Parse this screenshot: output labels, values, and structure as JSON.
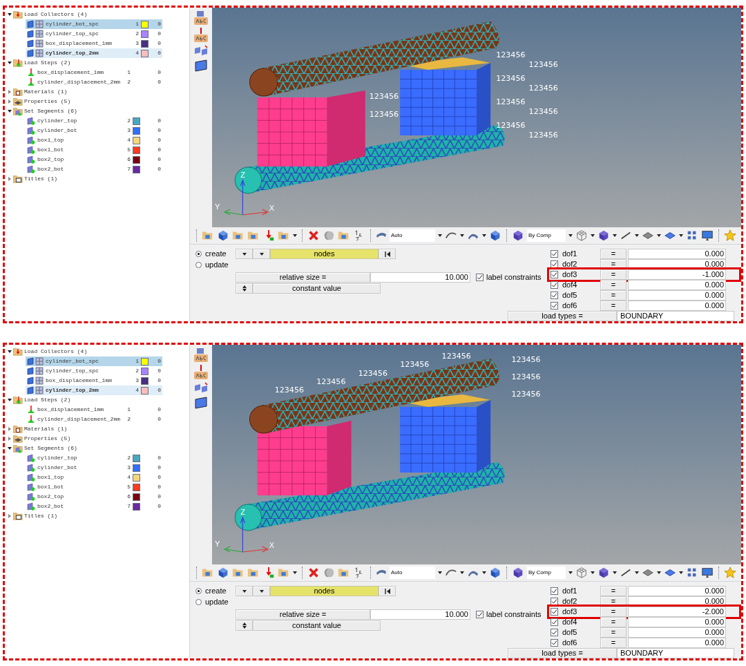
{
  "panels": [
    {
      "tree": [
        {
          "kind": "collectors",
          "label": "Load Collectors (4)",
          "expanded": true,
          "children": [
            {
              "label": "cylinder_bot_spc",
              "id": "1",
              "color": "#ffff00",
              "count": "0",
              "selected": true,
              "current": false
            },
            {
              "label": "cylinder_top_spc",
              "id": "2",
              "color": "#a982ff",
              "count": "0",
              "selected": false,
              "current": false
            },
            {
              "label": "box_displacement_1mm",
              "id": "3",
              "color": "#4a2f7f",
              "count": "0",
              "selected": false,
              "current": false
            },
            {
              "label": "cylinder_top_2mm",
              "id": "4",
              "color": "#ffbcbc",
              "count": "0",
              "selected": false,
              "current": true
            }
          ]
        },
        {
          "kind": "steps",
          "label": "Load Steps (2)",
          "expanded": true,
          "children": [
            {
              "label": "box_displacement_1mm",
              "id": "1",
              "count": "0",
              "selected": false,
              "current": false
            },
            {
              "label": "cylinder_displacement_2mm",
              "id": "2",
              "count": "0",
              "selected": false,
              "current": false
            }
          ]
        },
        {
          "kind": "materials",
          "label": "Materials (1)",
          "expanded": false
        },
        {
          "kind": "properties",
          "label": "Properties (5)",
          "expanded": false
        },
        {
          "kind": "segments",
          "label": "Set Segments (6)",
          "expanded": true,
          "children": [
            {
              "label": "cylinder_top",
              "id": "2",
              "color": "#48a8c0",
              "count": "0",
              "selected": false,
              "current": false
            },
            {
              "label": "cylinder_bot",
              "id": "3",
              "color": "#3070ff",
              "count": "0",
              "selected": false,
              "current": false
            },
            {
              "label": "box1_top",
              "id": "4",
              "color": "#f5d67a",
              "count": "0",
              "selected": false,
              "current": false
            },
            {
              "label": "box1_bot",
              "id": "5",
              "color": "#ff3a1e",
              "count": "0",
              "selected": false,
              "current": false
            },
            {
              "label": "box2_top",
              "id": "6",
              "color": "#7a0010",
              "count": "0",
              "selected": false,
              "current": false
            },
            {
              "label": "box2_bot",
              "id": "7",
              "color": "#6a2aa0",
              "count": "0",
              "selected": false,
              "current": false
            }
          ]
        },
        {
          "kind": "titles",
          "label": "Titles (1)",
          "expanded": false
        }
      ],
      "viewport": {
        "axes": [
          "Z",
          "Y",
          "X"
        ],
        "constraint_labels": [
          "123456",
          "123456",
          "123456",
          "123456",
          "123456",
          "123456",
          "123456",
          "123456",
          "123456",
          "123456"
        ]
      },
      "toolbar": {
        "mesh_mode": "Auto",
        "color_mode": "By Comp"
      },
      "form": {
        "modes": [
          {
            "label": "create",
            "selected": true
          },
          {
            "label": "update",
            "selected": false
          }
        ],
        "entity": "nodes",
        "size_label": "relative size =",
        "size_value": "10.000",
        "label_constraints": {
          "label": "label constraints",
          "checked": true
        },
        "value_mode": "constant value",
        "dofs": [
          {
            "label": "dof1",
            "checked": true,
            "operator": "=",
            "value": "0.000",
            "highlighted": false
          },
          {
            "label": "dof2",
            "checked": true,
            "operator": "=",
            "value": "0.000",
            "highlighted": false
          },
          {
            "label": "dof3",
            "checked": true,
            "operator": "=",
            "value": "-1.000",
            "highlighted": true
          },
          {
            "label": "dof4",
            "checked": true,
            "operator": "=",
            "value": "0.000",
            "highlighted": false
          },
          {
            "label": "dof5",
            "checked": true,
            "operator": "=",
            "value": "0.000",
            "highlighted": false
          },
          {
            "label": "dof6",
            "checked": true,
            "operator": "=",
            "value": "0.000",
            "highlighted": false
          }
        ],
        "load_types_label": "load types =",
        "load_types_value": "BOUNDARY"
      }
    },
    {
      "tree": [
        {
          "kind": "collectors",
          "label": "Load Collectors (4)",
          "expanded": true,
          "children": [
            {
              "label": "cylinder_bot_spc",
              "id": "1",
              "color": "#ffff00",
              "count": "0",
              "selected": true,
              "current": false
            },
            {
              "label": "cylinder_top_spc",
              "id": "2",
              "color": "#a982ff",
              "count": "0",
              "selected": false,
              "current": false
            },
            {
              "label": "box_displacement_1mm",
              "id": "3",
              "color": "#4a2f7f",
              "count": "0",
              "selected": false,
              "current": false
            },
            {
              "label": "cylinder_top_2mm",
              "id": "4",
              "color": "#ffbcbc",
              "count": "0",
              "selected": false,
              "current": true
            }
          ]
        },
        {
          "kind": "steps",
          "label": "Load Steps (2)",
          "expanded": true,
          "children": [
            {
              "label": "box_displacement_1mm",
              "id": "1",
              "count": "0",
              "selected": false,
              "current": false
            },
            {
              "label": "cylinder_displacement_2mm",
              "id": "2",
              "count": "0",
              "selected": false,
              "current": false
            }
          ]
        },
        {
          "kind": "materials",
          "label": "Materials (1)",
          "expanded": false
        },
        {
          "kind": "properties",
          "label": "Properties (5)",
          "expanded": false
        },
        {
          "kind": "segments",
          "label": "Set Segments (6)",
          "expanded": true,
          "children": [
            {
              "label": "cylinder_top",
              "id": "2",
              "color": "#48a8c0",
              "count": "0",
              "selected": false,
              "current": false
            },
            {
              "label": "cylinder_bot",
              "id": "3",
              "color": "#3070ff",
              "count": "0",
              "selected": false,
              "current": false
            },
            {
              "label": "box1_top",
              "id": "4",
              "color": "#f5d67a",
              "count": "0",
              "selected": false,
              "current": false
            },
            {
              "label": "box1_bot",
              "id": "5",
              "color": "#ff3a1e",
              "count": "0",
              "selected": false,
              "current": false
            },
            {
              "label": "box2_top",
              "id": "6",
              "color": "#7a0010",
              "count": "0",
              "selected": false,
              "current": false
            },
            {
              "label": "box2_bot",
              "id": "7",
              "color": "#6a2aa0",
              "count": "0",
              "selected": false,
              "current": false
            }
          ]
        },
        {
          "kind": "titles",
          "label": "Titles (1)",
          "expanded": false
        }
      ],
      "viewport": {
        "axes": [
          "Z",
          "Y",
          "X"
        ],
        "constraint_labels": [
          "123456",
          "123456",
          "123456",
          "123456",
          "123456",
          "123456",
          "123456",
          "123456"
        ]
      },
      "toolbar": {
        "mesh_mode": "Auto",
        "color_mode": "By Comp"
      },
      "form": {
        "modes": [
          {
            "label": "create",
            "selected": true
          },
          {
            "label": "update",
            "selected": false
          }
        ],
        "entity": "nodes",
        "size_label": "relative size =",
        "size_value": "10.000",
        "label_constraints": {
          "label": "label constraints",
          "checked": true
        },
        "value_mode": "constant value",
        "dofs": [
          {
            "label": "dof1",
            "checked": true,
            "operator": "=",
            "value": "0.000",
            "highlighted": false
          },
          {
            "label": "dof2",
            "checked": true,
            "operator": "=",
            "value": "0.000",
            "highlighted": false
          },
          {
            "label": "dof3",
            "checked": true,
            "operator": "=",
            "value": "-2.000",
            "highlighted": true
          },
          {
            "label": "dof4",
            "checked": true,
            "operator": "=",
            "value": "0.000",
            "highlighted": false
          },
          {
            "label": "dof5",
            "checked": true,
            "operator": "=",
            "value": "0.000",
            "highlighted": false
          },
          {
            "label": "dof6",
            "checked": true,
            "operator": "=",
            "value": "0.000",
            "highlighted": false
          }
        ],
        "load_types_label": "load types =",
        "load_types_value": "BOUNDARY"
      }
    }
  ]
}
